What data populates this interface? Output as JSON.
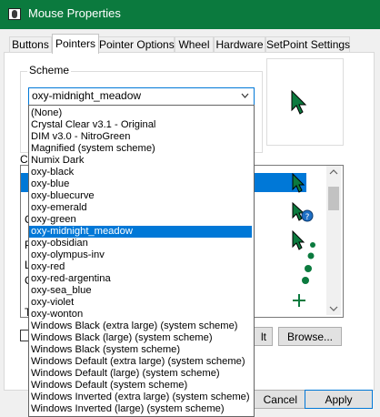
{
  "window": {
    "title": "Mouse Properties",
    "accent_color": "#0b7a3e",
    "icon": "mouse-icon"
  },
  "tabs": [
    {
      "label": "Buttons",
      "active": false
    },
    {
      "label": "Pointers",
      "active": true
    },
    {
      "label": "Pointer Options",
      "active": false
    },
    {
      "label": "Wheel",
      "active": false
    },
    {
      "label": "Hardware",
      "active": false
    },
    {
      "label": "SetPoint Settings",
      "active": false
    }
  ],
  "scheme": {
    "group_label": "Scheme",
    "selected": "oxy-midnight_meadow",
    "options": [
      "(None)",
      "Crystal Clear v3.1 - Original",
      "DIM v3.0 - NitroGreen",
      "Magnified (system scheme)",
      "Numix Dark",
      "oxy-black",
      "oxy-blue",
      "oxy-bluecurve",
      "oxy-emerald",
      "oxy-green",
      "oxy-midnight_meadow",
      "oxy-obsidian",
      "oxy-olympus-inv",
      "oxy-red",
      "oxy-red-argentina",
      "oxy-sea_blue",
      "oxy-violet",
      "oxy-wonton",
      "Windows Black (extra large) (system scheme)",
      "Windows Black (large) (system scheme)",
      "Windows Black (system scheme)",
      "Windows Default (extra large) (system scheme)",
      "Windows Default (large) (system scheme)",
      "Windows Default (system scheme)",
      "Windows Inverted (extra large) (system scheme)",
      "Windows Inverted (large) (system scheme)"
    ],
    "highlighted_index": 10,
    "selection_color": "#0078d7"
  },
  "customize": {
    "label_fragment": "Cu",
    "side_letters": [
      "C",
      "P",
      "L",
      "C",
      "T"
    ],
    "cursor_color": "#0b7a3e"
  },
  "buttons": {
    "use_default_fragment": "lt",
    "browse": "Browse...",
    "cancel": "Cancel",
    "apply": "Apply"
  }
}
